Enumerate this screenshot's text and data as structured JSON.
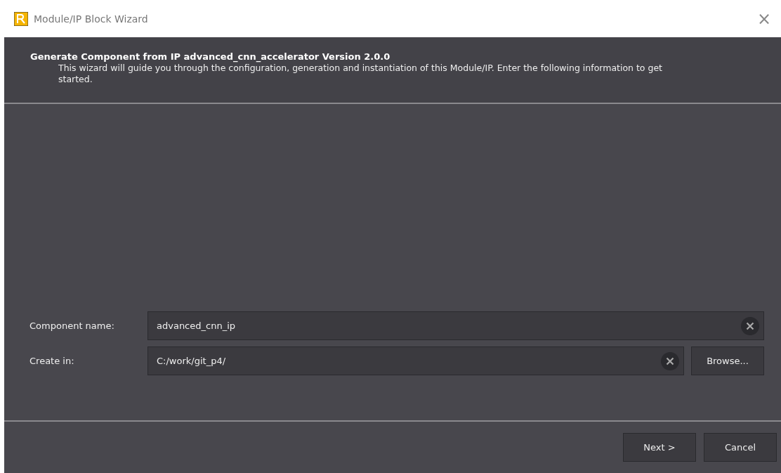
{
  "window": {
    "title": "Module/IP Block Wizard",
    "close": "×"
  },
  "header": {
    "title": "Generate Component from IP advanced_cnn_accelerator Version 2.0.0",
    "description": "This wizard will guide you through the configuration, generation and instantiation of this Module/IP. Enter the following information to get started."
  },
  "fields": [
    {
      "label": "Component name:",
      "value": "advanced_cnn_ip",
      "clearable": true
    },
    {
      "label": "Create in:",
      "value": "C:/work/git_p4/",
      "clearable": true,
      "button": "Browse..."
    }
  ],
  "buttons": [
    "Next >",
    "Cancel"
  ]
}
